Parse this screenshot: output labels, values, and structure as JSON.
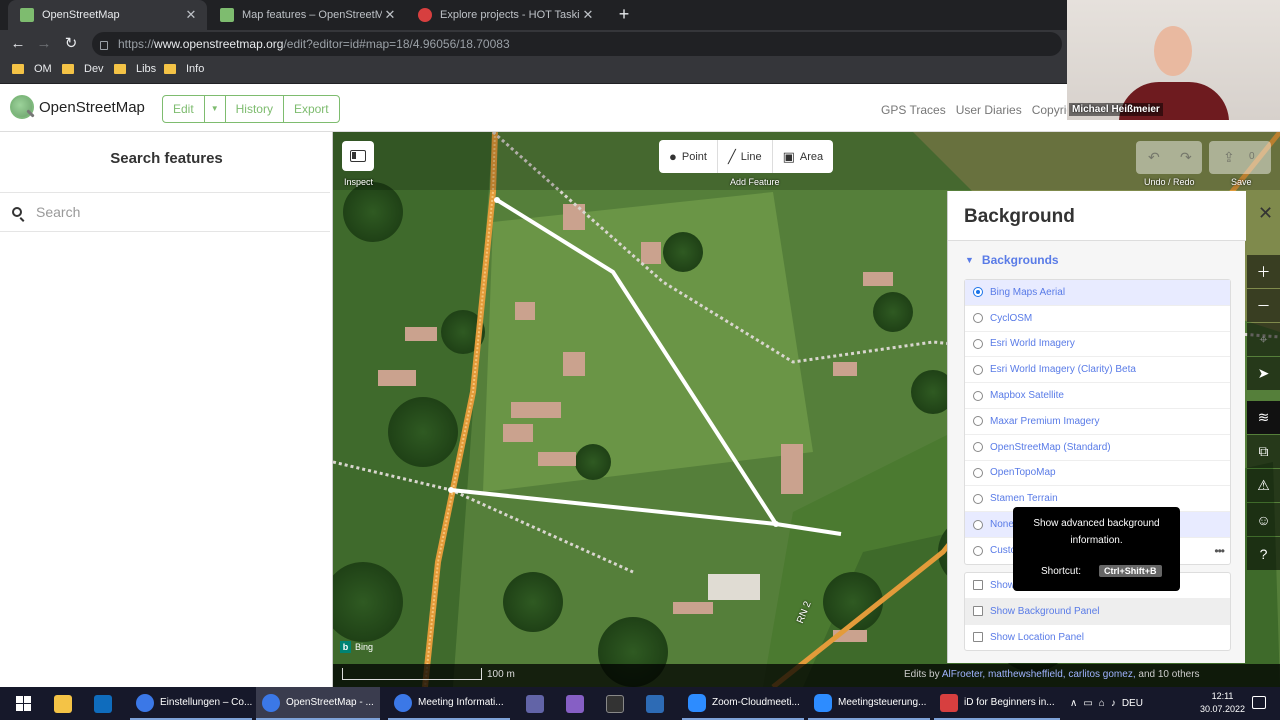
{
  "browser": {
    "tabs": [
      {
        "title": "OpenStreetMap",
        "favicon_color": "#7ebc6f"
      },
      {
        "title": "Map features – OpenStreetMap W",
        "favicon_color": "#7ebc6f"
      },
      {
        "title": "Explore projects - HOT Tasking M",
        "favicon_color": "#d73f3f"
      }
    ],
    "new_tab_glyph": "+",
    "url_prefix": "https://",
    "url_host": "www.openstreetmap.org",
    "url_path": "/edit?editor=id#map=18/4.96056/18.70083",
    "bookmarks": [
      "OM",
      "Dev",
      "Libs",
      "Info"
    ]
  },
  "osm_header": {
    "brand": "OpenStreetMap",
    "edit": "Edit",
    "history": "History",
    "export": "Export",
    "links": [
      "GPS Traces",
      "User Diaries",
      "Copyright"
    ]
  },
  "sidebar": {
    "title": "Search features",
    "search_placeholder": "Search"
  },
  "toolbar": {
    "inspect": "Inspect",
    "point": "Point",
    "line": "Line",
    "area": "Area",
    "add_feature": "Add Feature",
    "undo_redo": "Undo / Redo",
    "save": "Save",
    "save_count": "0"
  },
  "background_pane": {
    "title": "Background",
    "section": "Backgrounds",
    "layers": [
      {
        "label": "Bing Maps Aerial",
        "selected": true
      },
      {
        "label": "CyclOSM",
        "selected": false
      },
      {
        "label": "Esri World Imagery",
        "selected": false
      },
      {
        "label": "Esri World Imagery (Clarity) Beta",
        "selected": false
      },
      {
        "label": "Mapbox Satellite",
        "selected": false
      },
      {
        "label": "Maxar Premium Imagery",
        "selected": false
      },
      {
        "label": "OpenStreetMap (Standard)",
        "selected": false
      },
      {
        "label": "OpenTopoMap",
        "selected": false
      },
      {
        "label": "Stamen Terrain",
        "selected": false
      },
      {
        "label": "None",
        "selected": false
      },
      {
        "label": "Custo",
        "selected": false
      }
    ],
    "options": [
      {
        "label": "Show"
      },
      {
        "label": "Show Background Panel"
      },
      {
        "label": "Show Location Panel"
      }
    ]
  },
  "tooltip": {
    "text": "Show advanced background information.",
    "shortcut_label": "Shortcut:",
    "shortcut_key": "Ctrl+Shift+B"
  },
  "map": {
    "attribution": "Bing",
    "scale_label": "100 m",
    "road_label": "RN 2",
    "edits_prefix": "Edits by",
    "editors": "AlFroeter, matthewsheffield, carlitos gomez,",
    "edits_suffix": "and 10 others"
  },
  "webcam": {
    "participant": "Michael Heißmeier"
  },
  "taskbar": {
    "items": [
      {
        "label": "Einstellungen – Co...",
        "color": "#3b78e7"
      },
      {
        "label": "OpenStreetMap - ...",
        "color": "#3b78e7"
      },
      {
        "label": "Meeting Informati...",
        "color": "#3b78e7"
      },
      {
        "label": "Zoom-Cloudmeeti...",
        "color": "#2d8cff"
      },
      {
        "label": "Meetingsteuerung...",
        "color": "#2d8cff"
      },
      {
        "label": "iD for Beginners in...",
        "color": "#d73f3f"
      }
    ],
    "lang": "DEU",
    "time": "12:11",
    "date": "30.07.2022"
  }
}
